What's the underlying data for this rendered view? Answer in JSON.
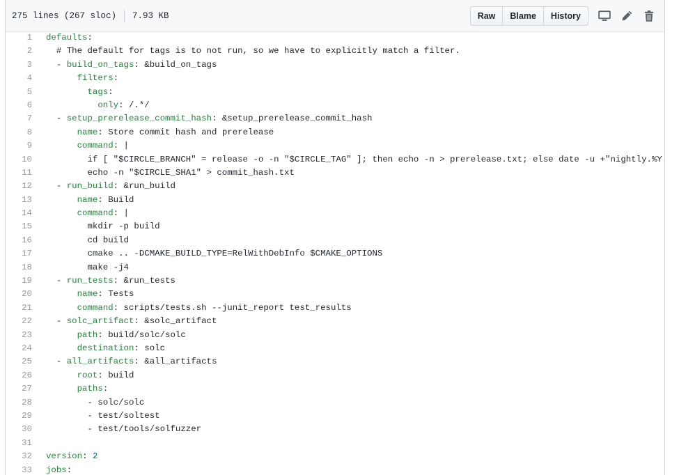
{
  "file_info": {
    "lines": "275 lines (267 sloc)",
    "size": "7.93 KB"
  },
  "toolbar": {
    "raw_label": "Raw",
    "blame_label": "Blame",
    "history_label": "History",
    "desktop_icon": "desktop-icon",
    "edit_icon": "pencil-icon",
    "delete_icon": "trash-icon"
  },
  "colors": {
    "key": "#22863a",
    "number": "#005cc5",
    "line_number": "#9a9a9a"
  },
  "code_lines": [
    {
      "num": "1",
      "key": "defaults",
      "rest": ":",
      "indent": ""
    },
    {
      "num": "2",
      "text": "  # The default for tags is to not run, so we have to explicitly match a filter."
    },
    {
      "num": "3",
      "indent": "  - ",
      "key": "build_on_tags",
      "rest": ": &build_on_tags"
    },
    {
      "num": "4",
      "indent": "      ",
      "key": "filters",
      "rest": ":"
    },
    {
      "num": "5",
      "indent": "        ",
      "key": "tags",
      "rest": ":"
    },
    {
      "num": "6",
      "indent": "          ",
      "key": "only",
      "rest": ": /.*/"
    },
    {
      "num": "7",
      "indent": "  - ",
      "key": "setup_prerelease_commit_hash",
      "rest": ": &setup_prerelease_commit_hash"
    },
    {
      "num": "8",
      "indent": "      ",
      "key": "name",
      "rest": ": Store commit hash and prerelease"
    },
    {
      "num": "9",
      "indent": "      ",
      "key": "command",
      "rest": ": |"
    },
    {
      "num": "10",
      "text": "        if [ \"$CIRCLE_BRANCH\" = release -o -n \"$CIRCLE_TAG\" ]; then echo -n > prerelease.txt; else date -u +\"nightly.%Y.%-m.%-d"
    },
    {
      "num": "11",
      "text": "        echo -n \"$CIRCLE_SHA1\" > commit_hash.txt"
    },
    {
      "num": "12",
      "indent": "  - ",
      "key": "run_build",
      "rest": ": &run_build"
    },
    {
      "num": "13",
      "indent": "      ",
      "key": "name",
      "rest": ": Build"
    },
    {
      "num": "14",
      "indent": "      ",
      "key": "command",
      "rest": ": |"
    },
    {
      "num": "15",
      "text": "        mkdir -p build"
    },
    {
      "num": "16",
      "text": "        cd build"
    },
    {
      "num": "17",
      "text": "        cmake .. -DCMAKE_BUILD_TYPE=RelWithDebInfo $CMAKE_OPTIONS"
    },
    {
      "num": "18",
      "text": "        make -j4"
    },
    {
      "num": "19",
      "indent": "  - ",
      "key": "run_tests",
      "rest": ": &run_tests"
    },
    {
      "num": "20",
      "indent": "      ",
      "key": "name",
      "rest": ": Tests"
    },
    {
      "num": "21",
      "indent": "      ",
      "key": "command",
      "rest": ": scripts/tests.sh --junit_report test_results"
    },
    {
      "num": "22",
      "indent": "  - ",
      "key": "solc_artifact",
      "rest": ": &solc_artifact"
    },
    {
      "num": "23",
      "indent": "      ",
      "key": "path",
      "rest": ": build/solc/solc"
    },
    {
      "num": "24",
      "indent": "      ",
      "key": "destination",
      "rest": ": solc"
    },
    {
      "num": "25",
      "indent": "  - ",
      "key": "all_artifacts",
      "rest": ": &all_artifacts"
    },
    {
      "num": "26",
      "indent": "      ",
      "key": "root",
      "rest": ": build"
    },
    {
      "num": "27",
      "indent": "      ",
      "key": "paths",
      "rest": ":"
    },
    {
      "num": "28",
      "text": "        - solc/solc"
    },
    {
      "num": "29",
      "text": "        - test/soltest"
    },
    {
      "num": "30",
      "text": "        - test/tools/solfuzzer"
    },
    {
      "num": "31",
      "text": ""
    },
    {
      "num": "32",
      "indent": "",
      "key": "version",
      "rest": ": ",
      "numval": "2"
    },
    {
      "num": "33",
      "indent": "",
      "key": "jobs",
      "rest": ":"
    }
  ]
}
